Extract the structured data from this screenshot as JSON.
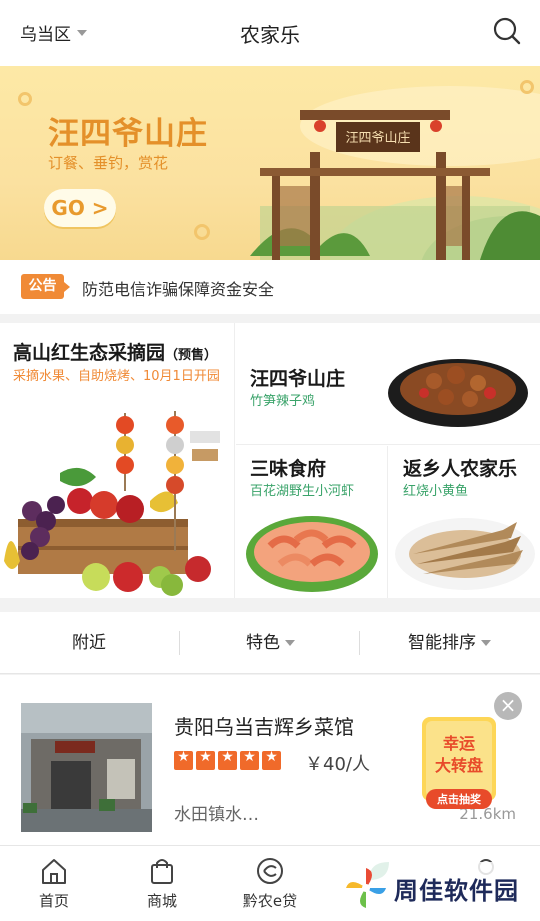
{
  "header": {
    "region": "乌当区",
    "title": "农家乐"
  },
  "banner": {
    "title": "汪四爷山庄",
    "subtitle": "订餐、垂钓，赏花",
    "go_label": "GO >",
    "gate_sign": "汪四爷山庄"
  },
  "notice": {
    "badge": "公告",
    "text": "防范电信诈骗保障资金安全"
  },
  "featured": [
    {
      "title": "高山红生态采摘园",
      "tag": "（预售）",
      "subtitle": "采摘水果、自助烧烤、10月1日开园",
      "subtitle_color": "#f08a36"
    },
    {
      "title": "汪四爷山庄",
      "subtitle": "竹笋辣子鸡",
      "subtitle_color": "#3aa36a"
    },
    {
      "title": "三味食府",
      "subtitle": "百花湖野生小河虾",
      "subtitle_color": "#3aa36a"
    },
    {
      "title": "返乡人农家乐",
      "subtitle": "红烧小黄鱼",
      "subtitle_color": "#3aa36a"
    }
  ],
  "filters": [
    {
      "label": "附近",
      "has_caret": false
    },
    {
      "label": "特色",
      "has_caret": true
    },
    {
      "label": "智能排序",
      "has_caret": true
    }
  ],
  "listing": {
    "name": "贵阳乌当吉辉乡菜馆",
    "rating": 5,
    "price": "￥40/人",
    "address": "水田镇水…",
    "distance": "21.6km",
    "close_label": "×",
    "promo_line1": "幸运",
    "promo_line2": "大转盘",
    "promo_cta": "点击抽奖"
  },
  "bottom_nav": [
    {
      "label": "首页",
      "icon": "home-icon"
    },
    {
      "label": "商城",
      "icon": "shopping-bag-icon"
    },
    {
      "label": "黔农e贷",
      "icon": "loan-icon"
    },
    {
      "label": "",
      "icon": "leaf-icon"
    },
    {
      "label": "",
      "icon": "profile-icon"
    }
  ],
  "watermark": {
    "text": "周佳软件园"
  },
  "colors": {
    "accent_orange": "#f08a36",
    "accent_green": "#3aa36a",
    "star": "#f06a2a",
    "banner_bg": "#fde9a6"
  }
}
